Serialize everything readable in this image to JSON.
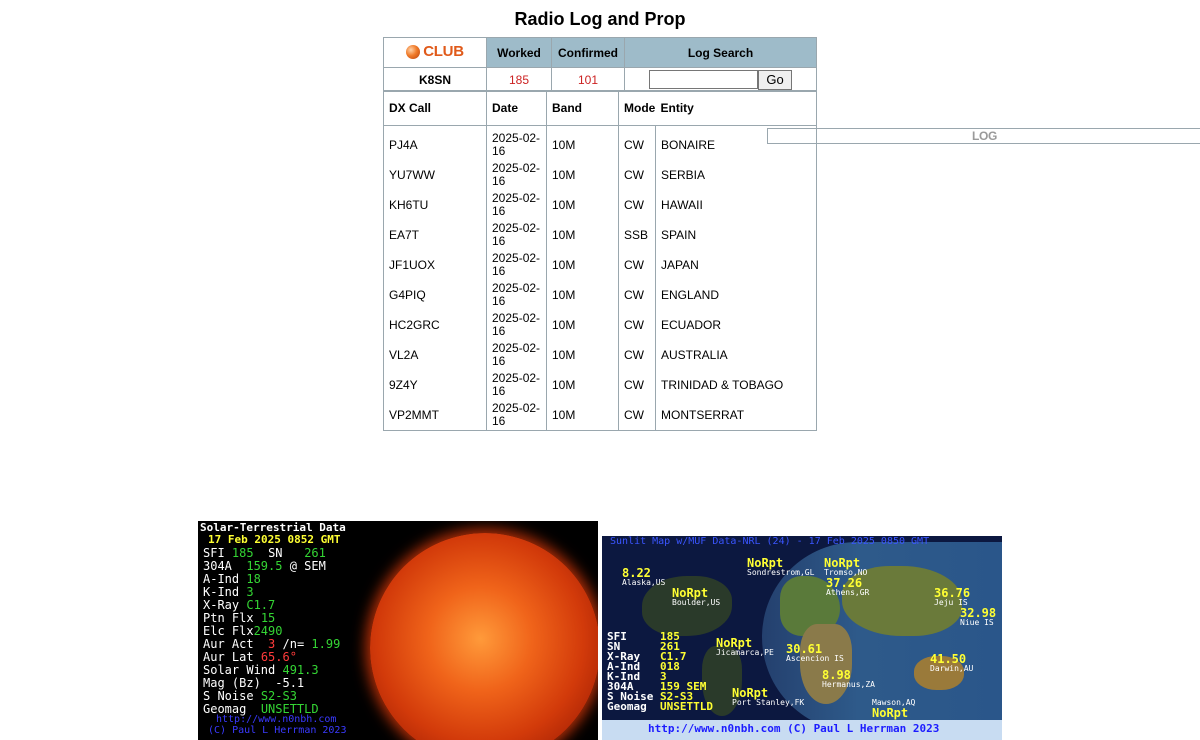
{
  "page": {
    "title": "Radio Log and Prop"
  },
  "summary": {
    "logo_club": "CLUB",
    "logo_log": "LOG",
    "headers": {
      "worked": "Worked",
      "confirmed": "Confirmed",
      "search": "Log Search"
    },
    "callsign": "K8SN",
    "worked": "185",
    "confirmed": "101",
    "search_value": "",
    "go_label": "Go"
  },
  "log": {
    "columns": [
      "DX Call",
      "Date",
      "Band",
      "Mode",
      "Entity"
    ],
    "rows": [
      {
        "call": "PJ4A",
        "date": "2025-02-16",
        "band": "10M",
        "mode": "CW",
        "entity": "BONAIRE"
      },
      {
        "call": "YU7WW",
        "date": "2025-02-16",
        "band": "10M",
        "mode": "CW",
        "entity": "SERBIA"
      },
      {
        "call": "KH6TU",
        "date": "2025-02-16",
        "band": "10M",
        "mode": "CW",
        "entity": "HAWAII"
      },
      {
        "call": "EA7T",
        "date": "2025-02-16",
        "band": "10M",
        "mode": "SSB",
        "entity": "SPAIN"
      },
      {
        "call": "JF1UOX",
        "date": "2025-02-16",
        "band": "10M",
        "mode": "CW",
        "entity": "JAPAN"
      },
      {
        "call": "G4PIQ",
        "date": "2025-02-16",
        "band": "10M",
        "mode": "CW",
        "entity": "ENGLAND"
      },
      {
        "call": "HC2GRC",
        "date": "2025-02-16",
        "band": "10M",
        "mode": "CW",
        "entity": "ECUADOR"
      },
      {
        "call": "VL2A",
        "date": "2025-02-16",
        "band": "10M",
        "mode": "CW",
        "entity": "AUSTRALIA"
      },
      {
        "call": "9Z4Y",
        "date": "2025-02-16",
        "band": "10M",
        "mode": "CW",
        "entity": "TRINIDAD & TOBAGO"
      },
      {
        "call": "VP2MMT",
        "date": "2025-02-16",
        "band": "10M",
        "mode": "CW",
        "entity": "MONTSERRAT"
      }
    ]
  },
  "solar": {
    "heading": "Solar-Terrestrial Data",
    "date": "17 Feb 2025 0852 GMT",
    "sfi_label": "SFI",
    "sfi": "185",
    "sn_label": "SN",
    "sn": "261",
    "a304_label": "304A",
    "a304": "159.5",
    "a304_suffix": "@ SEM",
    "aind_label": "A-Ind",
    "aind": "18",
    "kind_label": "K-Ind",
    "kind": "3",
    "xray_label": "X-Ray",
    "xray": "C1.7",
    "ptn_label": "Ptn Flx",
    "ptn": "15",
    "elc_label": "Elc Flx",
    "elc": "2490",
    "auract_label": "Aur Act",
    "auract": "3",
    "auract_mid": "/n=",
    "auract_n": "1.99",
    "aurlat_label": "Aur Lat",
    "aurlat": "65.6°",
    "wind_label": "Solar Wind",
    "wind": "491.3",
    "mag_label": "Mag (Bz)",
    "mag": "-5.1",
    "noise_label": "S Noise",
    "noise": "S2-S3",
    "geomag_label": "Geomag",
    "geomag": "UNSETTLD",
    "url": "http://www.n0nbh.com",
    "copyright": "(C) Paul L Herrman 2023"
  },
  "map": {
    "title": "Sunlit Map w/MUF Data-NRL (24) - 17 Feb 2025 0850 GMT",
    "stations": [
      {
        "value": "8.22",
        "name": "Alaska,US"
      },
      {
        "value": "NoRpt",
        "name": "Sondrestrom,GL"
      },
      {
        "value": "NoRpt",
        "name": "Tromso,NO"
      },
      {
        "value": "37.26",
        "name": "Athens,GR"
      },
      {
        "value": "36.76",
        "name": "Jeju IS"
      },
      {
        "value": "32.98",
        "name": "Niue IS"
      },
      {
        "value": "NoRpt",
        "name": "Boulder,US"
      },
      {
        "value": "NoRpt",
        "name": "Jicamarca,PE"
      },
      {
        "value": "30.61",
        "name": "Ascencion IS"
      },
      {
        "value": "41.50",
        "name": "Darwin,AU"
      },
      {
        "value": "8.98",
        "name": "Hermanus,ZA"
      },
      {
        "value": "NoRpt",
        "name": "Port Stanley,FK"
      },
      {
        "value": "NoRpt",
        "name": "Mawson,AQ"
      }
    ],
    "stats": {
      "sfi_label": "SFI",
      "sfi": "185",
      "sn_label": "SN",
      "sn": "261",
      "xray_label": "X-Ray",
      "xray": "C1.7",
      "aind_label": "A-Ind",
      "aind": "018",
      "kind_label": "K-Ind",
      "kind": "3",
      "a304_label": "304A",
      "a304": "159 SEM",
      "noise_label": "S Noise",
      "noise": "S2-S3",
      "geomag_label": "Geomag",
      "geomag": "UNSETTLD"
    },
    "footer": "http://www.n0nbh.com (C) Paul L Herrman 2023"
  },
  "colors": {
    "header_bg": "#9ebbc9",
    "count_red": "#cc2222",
    "clublog_orange": "#e05a1a",
    "solar_green": "#34d534",
    "map_yellow": "#ffff33"
  }
}
